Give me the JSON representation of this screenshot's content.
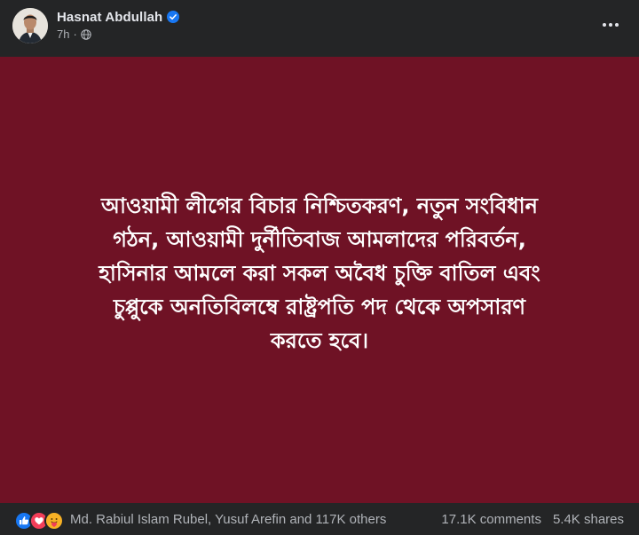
{
  "post": {
    "author": "Hasnat Abdullah",
    "time": "7h",
    "separator": "·",
    "verified": true,
    "privacy_icon": "globe-icon",
    "more_icon": "ellipsis-icon",
    "background_color": "#6f1225",
    "text_color": "#ffffff",
    "content_lines": [
      "আওয়ামী লীগের বিচার নিশ্চিতকরণ, নতুন সংবিধান",
      "গঠন, আওয়ামী দুর্নীতিবাজ আমলাদের পরিবর্তন,",
      "হাসিনার আমলে করা সকল অবৈধ চুক্তি বাতিল এবং",
      "চুপ্পুকে অনতিবিলম্বে রাষ্ট্রপতি পদ থেকে অপসারণ",
      "করতে হবে।"
    ]
  },
  "footer": {
    "reaction_icons": [
      "like-icon",
      "love-icon",
      "care-icon"
    ],
    "reactors": "Md. Rabiul Islam Rubel, Yusuf Arefin and 117K others",
    "comments": "17.1K comments",
    "shares": "5.4K shares"
  },
  "colors": {
    "surface": "#242526",
    "primary_text": "#e4e6eb",
    "secondary_text": "#b0b3b8",
    "verified_blue": "#1877f2"
  }
}
